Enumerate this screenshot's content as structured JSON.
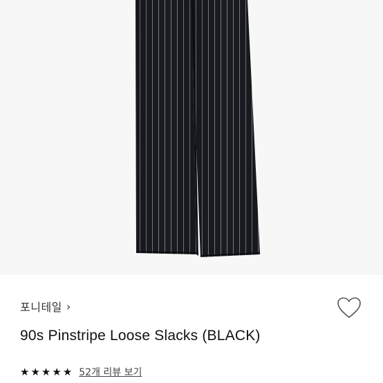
{
  "product": {
    "image_alt": "pinstripe-slacks-photo",
    "brand": "포니테일",
    "brand_chevron": "›",
    "title": "90s Pinstripe Loose Slacks (BLACK)",
    "rating_stars": 5,
    "review_link": "52개 리뷰 보기"
  },
  "icons": {
    "wish": "heart-outline-icon",
    "star": "star-icon",
    "chevron": "chevron-right-icon"
  },
  "colors": {
    "pants": "#1a1c22",
    "stripe": "#9a9ca3",
    "image_bg": "#f7f7f7"
  }
}
